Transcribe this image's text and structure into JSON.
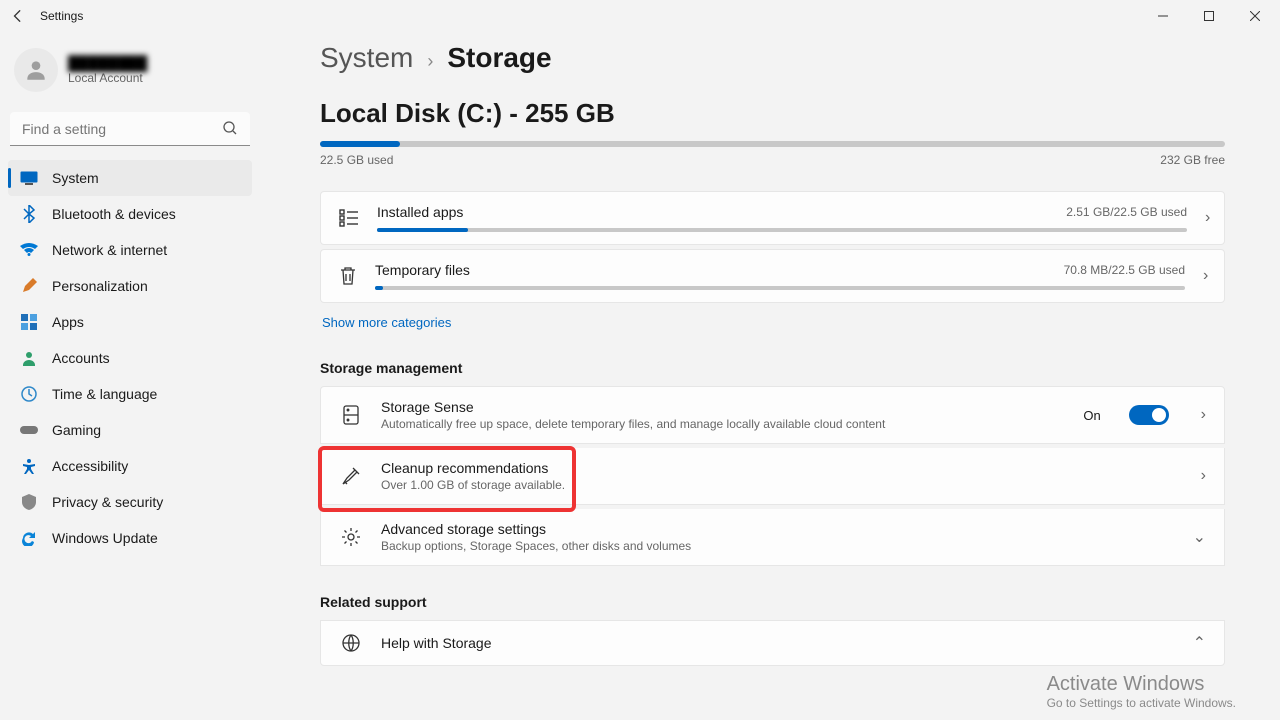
{
  "window": {
    "title": "Settings"
  },
  "account": {
    "name": "████████",
    "subtitle": "Local Account"
  },
  "search": {
    "placeholder": "Find a setting"
  },
  "nav": {
    "items": [
      {
        "label": "System"
      },
      {
        "label": "Bluetooth & devices"
      },
      {
        "label": "Network & internet"
      },
      {
        "label": "Personalization"
      },
      {
        "label": "Apps"
      },
      {
        "label": "Accounts"
      },
      {
        "label": "Time & language"
      },
      {
        "label": "Gaming"
      },
      {
        "label": "Accessibility"
      },
      {
        "label": "Privacy & security"
      },
      {
        "label": "Windows Update"
      }
    ],
    "selected_index": 0
  },
  "breadcrumb": {
    "parent": "System",
    "page": "Storage"
  },
  "disk": {
    "title": "Local Disk (C:) - 255 GB",
    "used_label": "22.5 GB used",
    "free_label": "232 GB free",
    "used_pct": 8.8
  },
  "categories": [
    {
      "title": "Installed apps",
      "stat": "2.51 GB/22.5 GB used",
      "pct": 11.2
    },
    {
      "title": "Temporary files",
      "stat": "70.8 MB/22.5 GB used",
      "pct": 1
    }
  ],
  "show_more": "Show more categories",
  "section_mgmt": "Storage management",
  "mgmt": [
    {
      "title": "Storage Sense",
      "sub": "Automatically free up space, delete temporary files, and manage locally available cloud content",
      "toggle_label": "On",
      "type": "toggle"
    },
    {
      "title": "Cleanup recommendations",
      "sub": "Over 1.00 GB of storage available.",
      "type": "nav",
      "highlighted": true
    },
    {
      "title": "Advanced storage settings",
      "sub": "Backup options, Storage Spaces, other disks and volumes",
      "type": "expand"
    }
  ],
  "section_related": "Related support",
  "related": [
    {
      "title": "Help with Storage"
    }
  ],
  "watermark": {
    "title": "Activate Windows",
    "sub": "Go to Settings to activate Windows."
  }
}
